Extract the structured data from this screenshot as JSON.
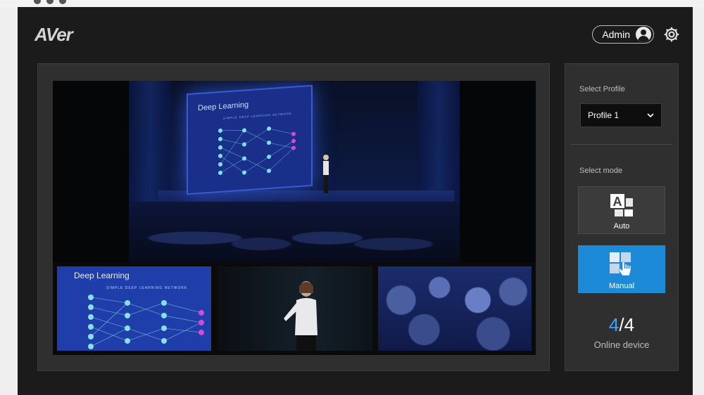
{
  "header": {
    "logo_text": "AVer",
    "user_label": "Admin"
  },
  "preview": {
    "main_slide_title": "Deep Learning",
    "main_slide_subtitle": "SIMPLE DEEP LEARNING NETWORK",
    "thumb_slide_title": "Deep Learning",
    "thumb_slide_subtitle": "SIMPLE DEEP LEARNING NETWORK"
  },
  "sidebar": {
    "profile_label": "Select Profile",
    "profile_value": "Profile 1",
    "mode_label": "Select mode",
    "modes": [
      {
        "label": "Auto",
        "selected": false
      },
      {
        "label": "Manual",
        "selected": true
      }
    ],
    "online_count": "4",
    "total_count": "4",
    "online_label": "Online device"
  },
  "colors": {
    "accent": "#1d8ad8",
    "count_highlight": "#3aa6ff",
    "background": "#1b1b1b",
    "panel": "#2f2f2f"
  },
  "icons": [
    "user-avatar-icon",
    "gear-icon",
    "chevron-down-icon",
    "auto-mode-icon",
    "manual-mode-icon"
  ]
}
